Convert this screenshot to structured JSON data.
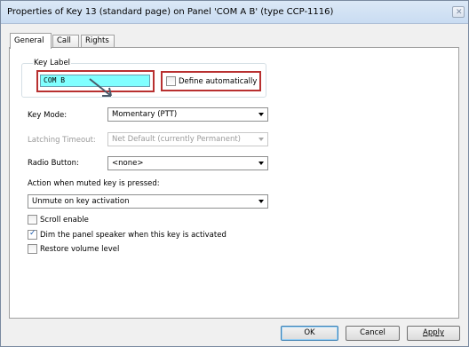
{
  "window": {
    "title": "Properties of Key 13 (standard page) on Panel 'COM A B' (type CCP-1116)"
  },
  "icons": {
    "close": "close-icon",
    "cursor": "cursor-arrow-icon"
  },
  "colors": {
    "highlight": "#b83030",
    "key_label_bg": "#80ffff"
  },
  "tabs": [
    {
      "label": "General"
    },
    {
      "label": "Call"
    },
    {
      "label": "Rights"
    }
  ],
  "key_label": {
    "group_title": "Key Label",
    "value": "COM B",
    "define_automatically": {
      "label": "Define automatically",
      "checked": false
    }
  },
  "fields": {
    "key_mode": {
      "label": "Key Mode:",
      "value": "Momentary (PTT)"
    },
    "latching_timeout": {
      "label": "Latching Timeout:",
      "value": "Net Default (currently Permanent)"
    },
    "radio_button": {
      "label": "Radio Button:",
      "value": "<none>"
    },
    "muted_action": {
      "label": "Action when muted key is pressed:",
      "value": "Unmute on key activation"
    }
  },
  "options": {
    "scroll_enable": {
      "label": "Scroll enable",
      "checked": false
    },
    "dim_speaker": {
      "label": "Dim the panel speaker when this key is activated",
      "checked": true
    },
    "restore_volume": {
      "label": "Restore volume level",
      "checked": false
    }
  },
  "buttons": {
    "ok": "OK",
    "cancel": "Cancel",
    "apply": "Apply"
  }
}
